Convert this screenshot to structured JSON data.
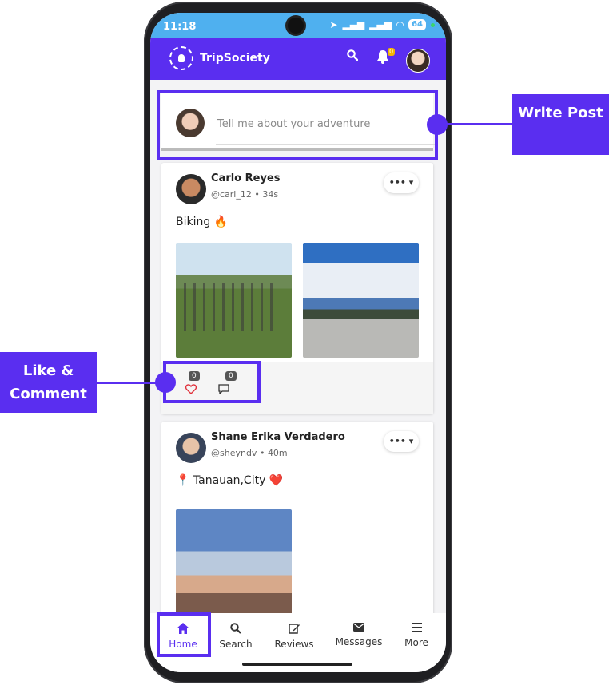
{
  "status_bar": {
    "time": "11:18",
    "battery": "64"
  },
  "app": {
    "name": "TripSociety",
    "notification_count": "0"
  },
  "composer": {
    "placeholder": "Tell me about your adventure"
  },
  "posts": [
    {
      "user": "Carlo Reyes",
      "handle": "@carl_12",
      "time": "34s",
      "text": "Biking 🔥",
      "likes": "0",
      "comments": "0",
      "more": "•••  ▾"
    },
    {
      "user": "Shane Erika Verdadero",
      "handle": "@sheyndv",
      "time": "40m",
      "text": "📍 Tanauan,City ❤️",
      "more": "•••  ▾"
    }
  ],
  "nav": [
    {
      "label": "Home",
      "icon": "home-icon",
      "active": true
    },
    {
      "label": "Search",
      "icon": "search-icon"
    },
    {
      "label": "Reviews",
      "icon": "edit-icon"
    },
    {
      "label": "Messages",
      "icon": "envelope-icon"
    },
    {
      "label": "More",
      "icon": "menu-icon"
    }
  ],
  "callouts": {
    "write_post": "Write Post",
    "like_comment": "Like & Comment"
  },
  "colors": {
    "brand": "#5a2ef0",
    "status_bar": "#4fb0ef",
    "like": "#e0323c",
    "badge": "#f5b400"
  }
}
